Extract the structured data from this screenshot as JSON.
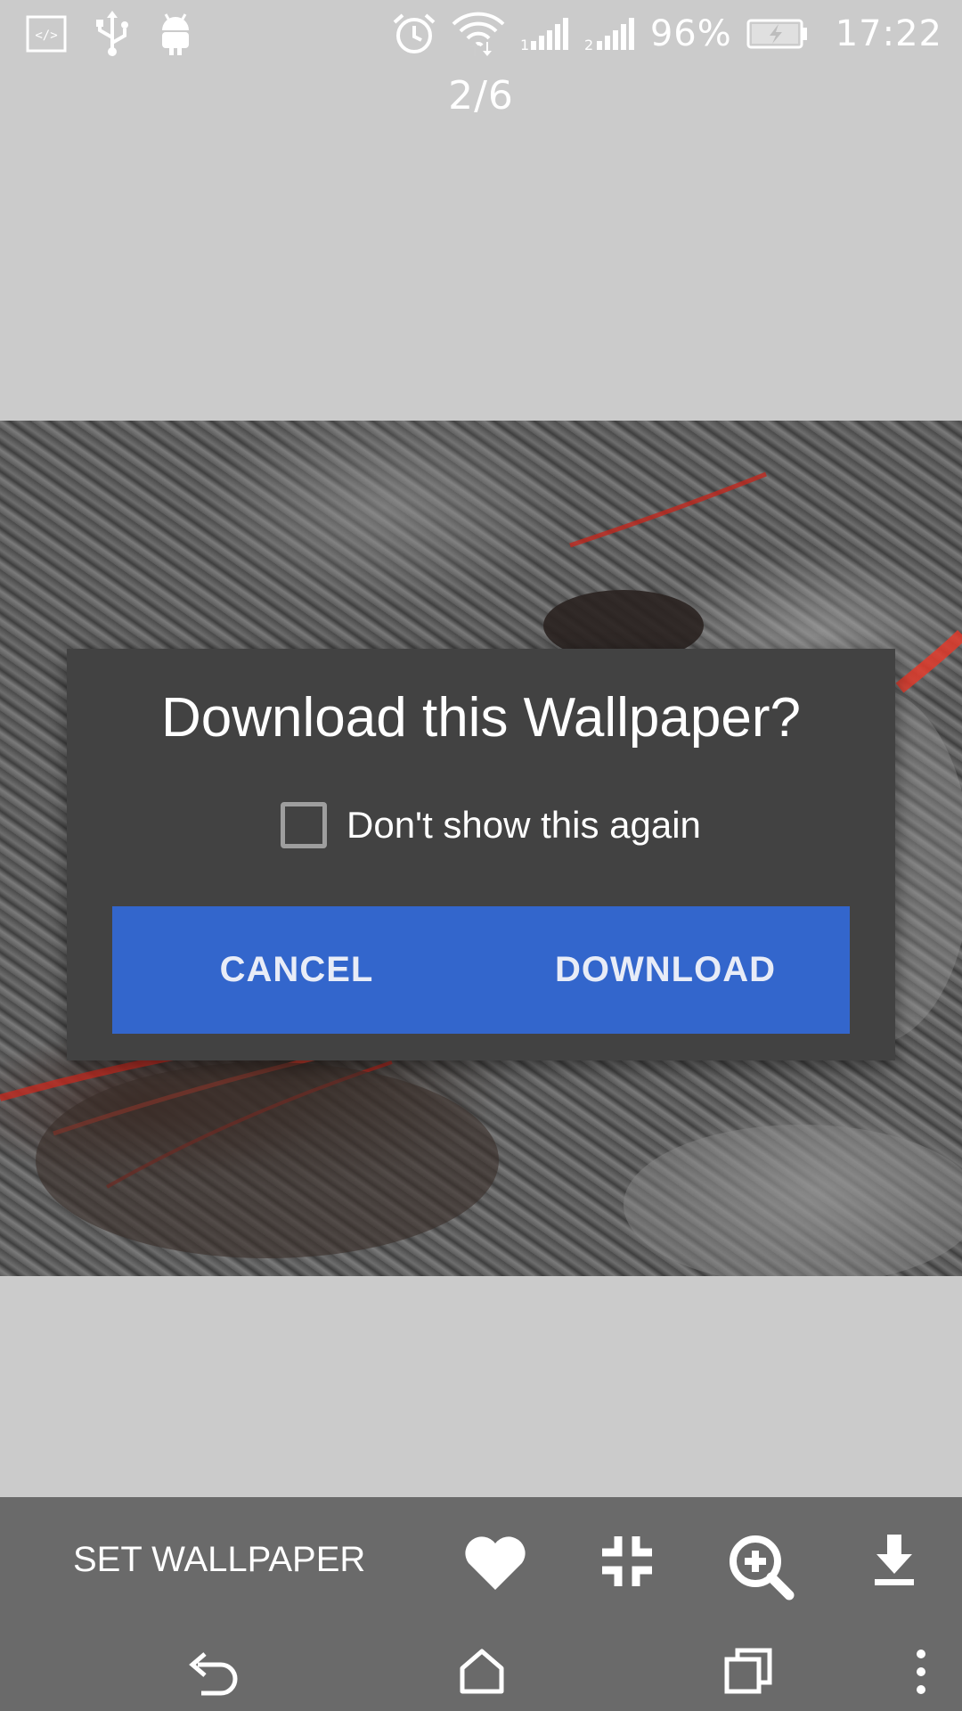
{
  "status_bar": {
    "battery_percent": "96%",
    "time": "17:22",
    "icons": [
      "developer-mode-icon",
      "usb-icon",
      "android-debug-icon",
      "alarm-icon",
      "wifi-icon",
      "signal-1-icon",
      "signal-2-icon",
      "battery-charging-icon"
    ]
  },
  "viewer": {
    "page_counter": "2/6"
  },
  "dialog": {
    "title": "Download this Wallpaper?",
    "checkbox_label": "Don't show this again",
    "checkbox_checked": false,
    "cancel_label": "CANCEL",
    "download_label": "DOWNLOAD",
    "button_color": "#3366cc"
  },
  "toolbar": {
    "set_wallpaper_label": "SET WALLPAPER",
    "icons": [
      "heart-icon",
      "fit-screen-icon",
      "zoom-in-icon",
      "download-icon"
    ]
  },
  "nav_bar": {
    "icons": [
      "back-icon",
      "home-icon",
      "recents-icon",
      "overflow-menu-icon"
    ]
  }
}
